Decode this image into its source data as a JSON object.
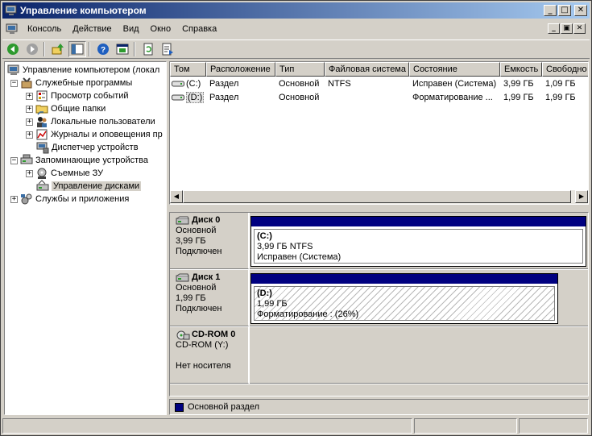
{
  "window": {
    "title": "Управление компьютером",
    "minimize": "_",
    "maximize": "□",
    "close": "✕"
  },
  "menu": {
    "items": [
      "Консоль",
      "Действие",
      "Вид",
      "Окно",
      "Справка"
    ]
  },
  "mdi": {
    "minimize": "_",
    "restore": "▣",
    "close": "✕"
  },
  "toolbar": {
    "icons": [
      "back-icon",
      "forward-icon",
      "up-level-icon",
      "show-hide-tree-icon",
      "help-icon",
      "properties-icon",
      "refresh-icon",
      "export-list-icon"
    ]
  },
  "tree": {
    "root": "Управление компьютером (локал",
    "utilities": "Служебные программы",
    "event_viewer": "Просмотр событий",
    "shared_folders": "Общие папки",
    "local_users": "Локальные пользователи",
    "logs_alerts": "Журналы и оповещения пр",
    "device_manager": "Диспетчер устройств",
    "storage": "Запоминающие устройства",
    "removable": "Съемные ЗУ",
    "disk_management": "Управление дисками",
    "services_apps": "Службы и приложения"
  },
  "volumes": {
    "columns": [
      "Том",
      "Расположение",
      "Тип",
      "Файловая система",
      "Состояние",
      "Емкость",
      "Свободно"
    ],
    "rows": [
      {
        "volume": "(C:)",
        "layout": "Раздел",
        "type": "Основной",
        "fs": "NTFS",
        "status": "Исправен (Система)",
        "capacity": "3,99 ГБ",
        "free": "1,09 ГБ"
      },
      {
        "volume": "(D:)",
        "layout": "Раздел",
        "type": "Основной",
        "fs": "",
        "status": "Форматирование ...",
        "capacity": "1,99 ГБ",
        "free": "1,99 ГБ"
      }
    ]
  },
  "disks": [
    {
      "name": "Диск 0",
      "kind": "Основной",
      "size": "3,99 ГБ",
      "state": "Подключен",
      "partition": {
        "label": "(C:)",
        "detail": "3,99 ГБ NTFS",
        "status": "Исправен (Система)"
      }
    },
    {
      "name": "Диск 1",
      "kind": "Основной",
      "size": "1,99 ГБ",
      "state": "Подключен",
      "partition": {
        "label": "(D:)",
        "detail": "1,99 ГБ",
        "status": "Форматирование : (26%)"
      }
    },
    {
      "name": "CD-ROM 0",
      "kind": "CD-ROM (Y:)",
      "size": "",
      "state": "Нет носителя"
    }
  ],
  "legend": {
    "primary": "Основной раздел"
  },
  "colors": {
    "partition_header": "#000080",
    "title_start": "#0a246a",
    "title_end": "#a6caf0"
  }
}
